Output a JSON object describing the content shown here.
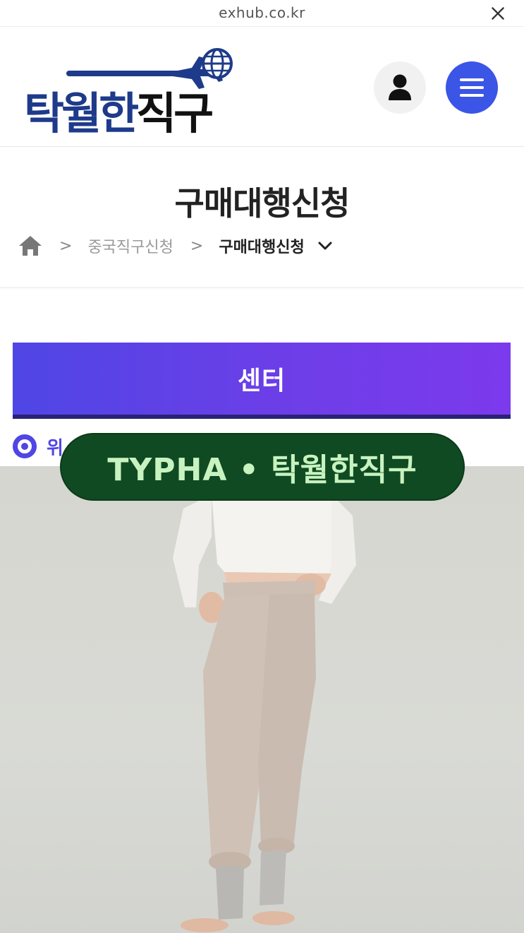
{
  "browser": {
    "url": "exhub.co.kr",
    "close_icon": "close-icon"
  },
  "header": {
    "logo_text_main": "탁월한",
    "logo_text_accent": "직구",
    "user_icon": "user-icon",
    "menu_icon": "hamburger-menu-icon",
    "colors": {
      "logo_blue": "#1e3a8a",
      "menu_button": "#3b55e6"
    }
  },
  "page": {
    "title": "구매대행신청",
    "breadcrumb": {
      "home_icon": "home-icon",
      "separator": ">",
      "items": [
        "중국직구신청",
        "구매대행신청"
      ]
    }
  },
  "center_bar": {
    "label": "센터",
    "gradient": [
      "#4f46e5",
      "#7c3aed"
    ]
  },
  "radio_option": {
    "label": "위",
    "selected": true
  },
  "watermark": {
    "text": "TYPHA • 탁월한직구",
    "background": "#0f4a22",
    "color": "#c8f3c0"
  },
  "product_image": {
    "subject": "product-photo"
  }
}
